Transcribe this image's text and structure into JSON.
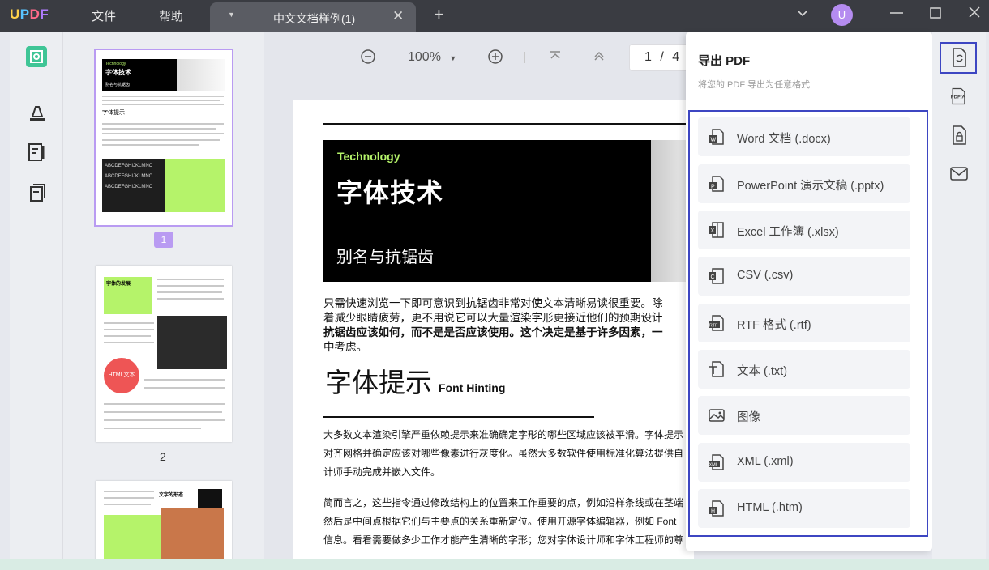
{
  "app": {
    "logo": [
      "U",
      "P",
      "D",
      "F"
    ],
    "menu": [
      "文件",
      "帮助"
    ],
    "tab_title": "中文文档样例(1)",
    "avatar_initial": "U",
    "accent": "#b99bf2",
    "highlight": "#3d46c2"
  },
  "toolbar": {
    "zoom": "100%",
    "page_current": "1",
    "page_sep": "/",
    "page_total": "4"
  },
  "thumbnails": {
    "selected_badge": "1",
    "page2_label": "2",
    "p1_tech": "Technology",
    "p1_title": "字体技术",
    "p1_sub": "别名与抗锯齿",
    "p1_heading": "字体提示",
    "p1_caption": "ABCDEFGHIJKLMNO",
    "p2_title": "字体的发展",
    "p2_html": "HTML文本",
    "p3_title": "文字的形态"
  },
  "document": {
    "tech": "Technology",
    "title": "字体技术",
    "subtitle": "别名与抗锯齿",
    "para1": [
      "只需快速浏览一下即可意识到抗锯齿非常对使文本清晰易读很重要。除",
      "着减少眼睛疲劳，更不用说它可以大量渲染字形更接近他们的预期设计",
      "抗锯齿应该如何，而不是是否应该使用。这个决定是基于许多因素，一",
      "中考虑。"
    ],
    "heading2": "字体提示",
    "heading2_en": "Font Hinting",
    "para2": [
      "大多数文本渲染引擎严重依赖提示来准确确定字形的哪些区域应该被平滑。字体提示",
      "对齐网格并确定应该对哪些像素进行灰度化。虽然大多数软件使用标准化算法提供自",
      "计师手动完成并嵌入文件。"
    ],
    "para3": [
      "简而言之，这些指令通过修改结构上的位置来工作重要的点，例如沿样条线或在茎端",
      "然后是中间点根据它们与主要点的关系重新定位。使用开源字体编辑器，例如 Font",
      "信息。看看需要做多少工作才能产生清晰的字形；您对字体设计师和字体工程师的尊"
    ]
  },
  "export_panel": {
    "title": "导出 PDF",
    "subtitle": "将您的 PDF 导出为任意格式",
    "items": [
      {
        "label": "Word 文档 (.docx)",
        "icon": "word-icon"
      },
      {
        "label": "PowerPoint 演示文稿 (.pptx)",
        "icon": "powerpoint-icon"
      },
      {
        "label": "Excel 工作簿 (.xlsx)",
        "icon": "excel-icon"
      },
      {
        "label": "CSV (.csv)",
        "icon": "csv-icon"
      },
      {
        "label": "RTF 格式 (.rtf)",
        "icon": "rtf-icon"
      },
      {
        "label": "文本 (.txt)",
        "icon": "text-icon"
      },
      {
        "label": "图像",
        "icon": "image-icon"
      },
      {
        "label": "XML (.xml)",
        "icon": "xml-icon"
      },
      {
        "label": "HTML (.htm)",
        "icon": "html-icon"
      }
    ]
  },
  "rightbar": {
    "pdfa_label": "PDF/A"
  }
}
